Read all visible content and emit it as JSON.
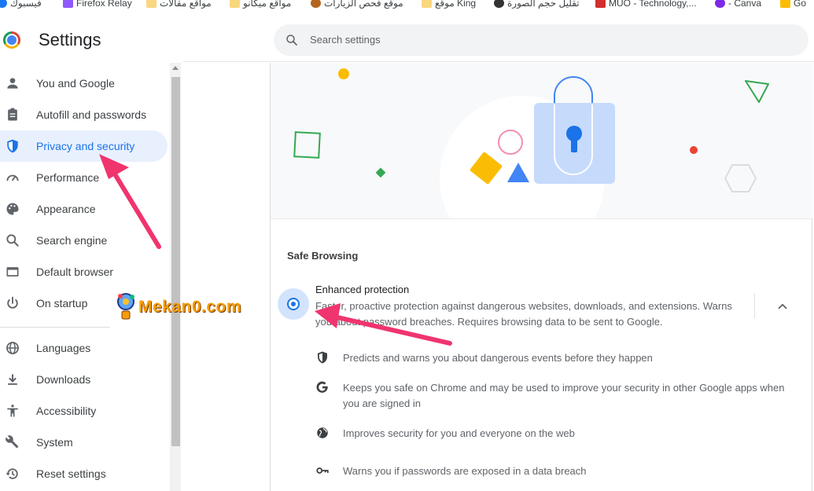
{
  "bookmarks": [
    {
      "label": "فيسبوك",
      "icon": "facebook-icon",
      "color": "#1877f2"
    },
    {
      "label": "Firefox Relay",
      "icon": "firefox-relay-icon",
      "color": "#9059ff"
    },
    {
      "label": "مواقع مقالات",
      "icon": "folder-icon",
      "color": "#f9d77e"
    },
    {
      "label": "مواقع ميكانو",
      "icon": "folder-icon",
      "color": "#f9d77e"
    },
    {
      "label": "موقع فحص الزيارات",
      "icon": "monkey-icon",
      "color": "#b5651d"
    },
    {
      "label": "موقع King",
      "icon": "folder-icon",
      "color": "#f9d77e"
    },
    {
      "label": "تقليل حجم الصورة",
      "icon": "panda-icon",
      "color": "#333333"
    },
    {
      "label": "MUO - Technology,...",
      "icon": "muo-icon",
      "color": "#d32f2f"
    },
    {
      "label": "- Canva",
      "icon": "canva-icon",
      "color": "#7d2ae8"
    },
    {
      "label": "Go",
      "icon": "google-ads-icon",
      "color": "#fbbc04"
    }
  ],
  "header": {
    "title": "Settings",
    "search_placeholder": "Search settings"
  },
  "sidebar": {
    "items": [
      {
        "label": "You and Google",
        "icon": "person-icon"
      },
      {
        "label": "Autofill and passwords",
        "icon": "clipboard-icon"
      },
      {
        "label": "Privacy and security",
        "icon": "shield-icon",
        "active": true
      },
      {
        "label": "Performance",
        "icon": "speedometer-icon"
      },
      {
        "label": "Appearance",
        "icon": "palette-icon"
      },
      {
        "label": "Search engine",
        "icon": "search-icon"
      },
      {
        "label": "Default browser",
        "icon": "browser-window-icon"
      },
      {
        "label": "On startup",
        "icon": "power-icon"
      },
      {
        "label": "Languages",
        "icon": "globe-icon"
      },
      {
        "label": "Downloads",
        "icon": "download-icon"
      },
      {
        "label": "Accessibility",
        "icon": "accessibility-icon"
      },
      {
        "label": "System",
        "icon": "wrench-icon"
      },
      {
        "label": "Reset settings",
        "icon": "history-icon"
      }
    ]
  },
  "watermark": {
    "text": "Mekan0.com"
  },
  "main": {
    "section_title": "Safe Browsing",
    "option": {
      "title": "Enhanced protection",
      "description": "Faster, proactive protection against dangerous websites, downloads, and extensions. Warns you about password breaches. Requires browsing data to be sent to Google.",
      "selected": true
    },
    "features": [
      {
        "icon": "shield-outline-icon",
        "text": "Predicts and warns you about dangerous events before they happen"
      },
      {
        "icon": "google-g-icon",
        "text": "Keeps you safe on Chrome and may be used to improve your security in other Google apps when you are signed in"
      },
      {
        "icon": "globe-icon",
        "text": "Improves security for you and everyone on the web"
      },
      {
        "icon": "key-icon",
        "text": "Warns you if passwords are exposed in a data breach"
      }
    ]
  },
  "colors": {
    "accent": "#1a73e8",
    "active_bg": "#e8f0fe",
    "annotation_arrow": "#f0346e"
  }
}
